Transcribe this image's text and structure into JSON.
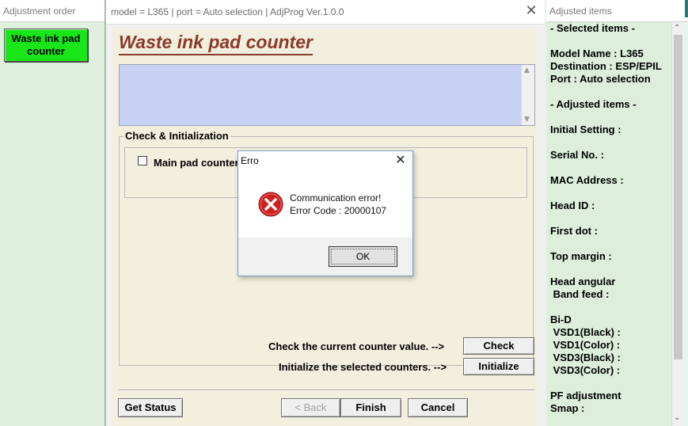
{
  "left_panel": {
    "title": "Adjustment order",
    "waste_button": "Waste ink pad counter"
  },
  "main_window": {
    "title": "model = L365 | port = Auto selection | AdjProg Ver.1.0.0",
    "close_glyph": "✕",
    "page_title": "Waste ink pad counter",
    "group_label": "Check & Initialization",
    "checkbox_label": "Main pad counter",
    "checkbox_checked": false,
    "check_hint": "Check the current counter value. -->",
    "check_button": "Check",
    "init_hint": "Initialize the selected counters. -->",
    "init_button": "Initialize",
    "get_status_button": "Get Status",
    "back_button": "< Back",
    "finish_button": "Finish",
    "cancel_button": "Cancel"
  },
  "dialog": {
    "title": "Erro",
    "close_glyph": "✕",
    "message": "Communication error!",
    "error_code": "Error Code : 20000107",
    "ok_button": "OK",
    "icon": "error-icon"
  },
  "right_panel": {
    "title": "Adjusted items",
    "lines": [
      "- Selected items -",
      "Model Name : L365",
      "Destination : ESP/EPIL",
      "Port : Auto selection",
      "- Adjusted items -",
      "Initial Setting :",
      "Serial No. :",
      "MAC Address :",
      "Head ID :",
      "First dot :",
      "Top margin :",
      "Head angular",
      " Band feed :",
      "Bi-D",
      " VSD1(Black) :",
      " VSD1(Color) :",
      " VSD3(Black) :",
      " VSD3(Color) :",
      "PF adjustment",
      "Smap :"
    ]
  },
  "colors": {
    "accent_green": "#19e619",
    "title_brown": "#8b3a2a",
    "info_box_blue": "#c8d2f5",
    "client_bg": "#f3efdf",
    "error_red": "#d02020"
  }
}
